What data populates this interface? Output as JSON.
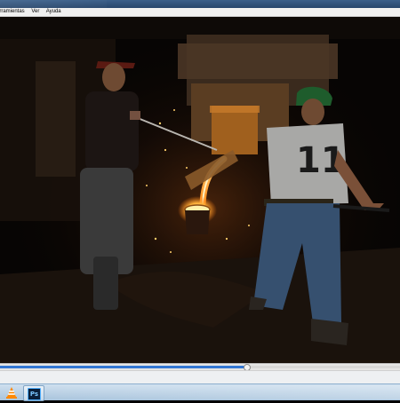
{
  "app": {
    "menu": [
      "erramientas",
      "Ver",
      "Ayuda"
    ]
  },
  "video": {
    "subject": "steelworks foundry pour",
    "jersey_number": "11"
  },
  "playback": {
    "progress": 0.615
  },
  "taskbar": {
    "apps": [
      {
        "icon": "vlc-cone-icon",
        "active": false
      },
      {
        "icon": "photoshop-icon",
        "label": "Ps",
        "active": true
      }
    ]
  },
  "colors": {
    "progress_fill": "#3377d4",
    "molten_metal": "#ffb040",
    "titlebar": "#2f5379"
  }
}
